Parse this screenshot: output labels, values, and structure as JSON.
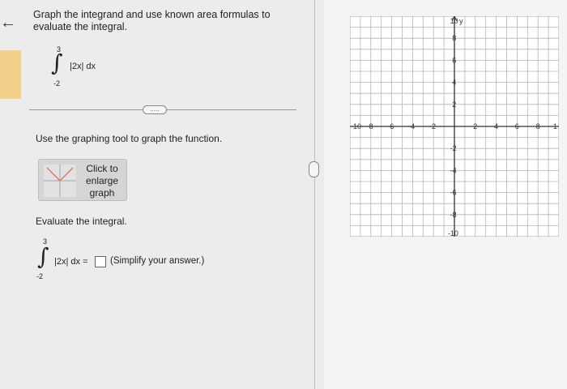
{
  "nav": {
    "back_icon": "arrow-left-icon"
  },
  "instructions": {
    "text": "Graph the integrand and use known area formulas to evaluate the integral."
  },
  "problem": {
    "upper_limit": "3",
    "lower_limit": "-2",
    "integrand": "|2x| dx"
  },
  "more_button": {
    "label": "....."
  },
  "graph_prompt": {
    "text": "Use the graphing tool to graph the function."
  },
  "enlarge_card": {
    "label": "Click to enlarge graph"
  },
  "evaluate": {
    "heading": "Evaluate the integral.",
    "upper_limit": "3",
    "lower_limit": "-2",
    "integrand": "|2x| dx =",
    "hint": "(Simplify your answer.)",
    "answer_value": ""
  },
  "graph": {
    "y_axis_label": "y",
    "x_ticks": [
      "-10",
      "-8",
      "-6",
      "-4",
      "-2",
      "2",
      "4",
      "6",
      "8",
      "1"
    ],
    "y_ticks": [
      "10",
      "8",
      "6",
      "4",
      "2",
      "-2",
      "-4",
      "-6",
      "-8",
      "-10"
    ],
    "x_range": [
      -10,
      10
    ],
    "y_range": [
      -10,
      10
    ],
    "grid": true
  }
}
